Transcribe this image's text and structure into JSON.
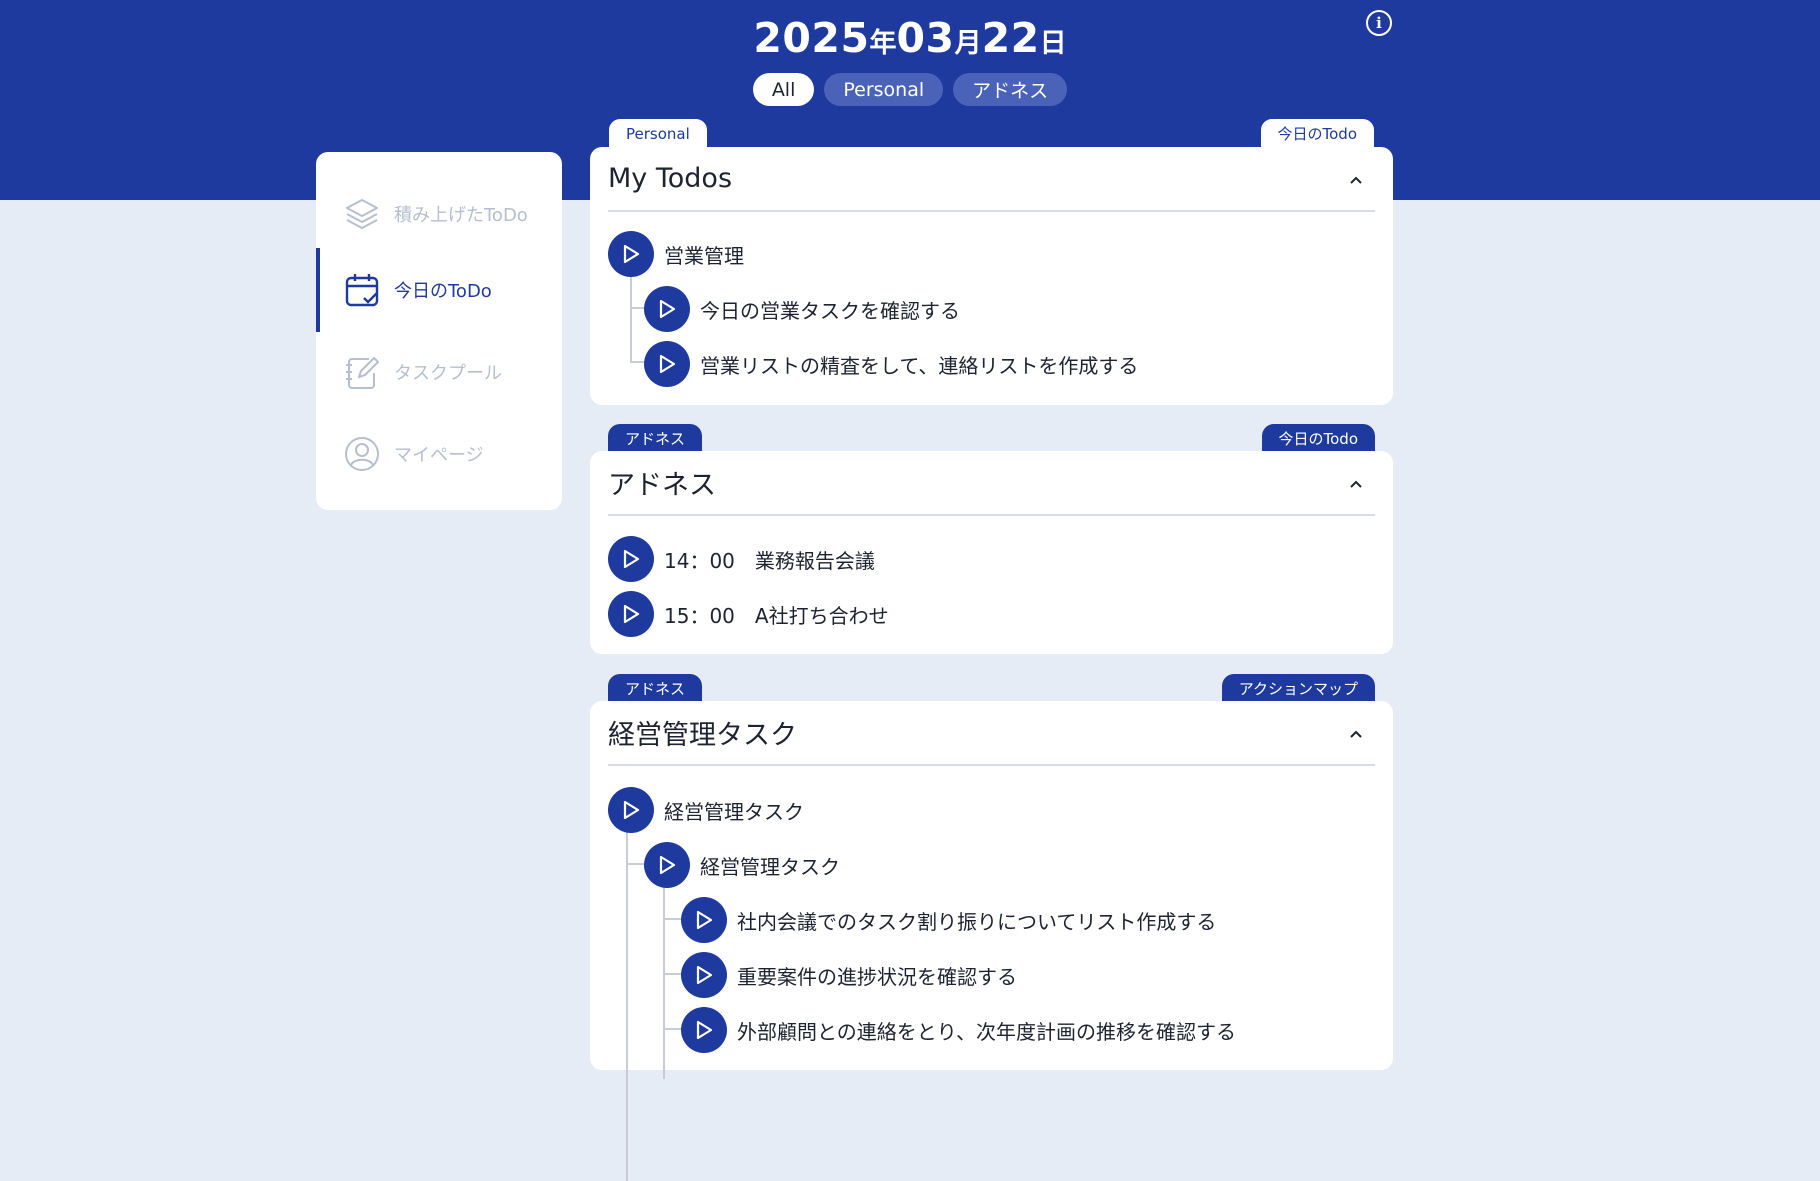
{
  "header": {
    "date_year": "2025",
    "date_year_suffix": "年",
    "date_month": "03",
    "date_month_suffix": "月",
    "date_day": "22",
    "date_day_suffix": "日",
    "info_icon": "info-icon",
    "filters": [
      "All",
      "Personal",
      "アドネス"
    ]
  },
  "sidebar": {
    "items": [
      {
        "label": "積み上げたToDo",
        "icon": "stack-layers-icon"
      },
      {
        "label": "今日のToDo",
        "icon": "calendar-check-icon"
      },
      {
        "label": "タスクプール",
        "icon": "notebook-edit-icon"
      },
      {
        "label": "マイページ",
        "icon": "user-circle-icon"
      }
    ]
  },
  "cards": [
    {
      "left_tab": "Personal",
      "right_tab": "今日のTodo",
      "title": "My Todos",
      "rows": [
        "営業管理",
        "今日の営業タスクを確認する",
        "営業リストの精査をして、連絡リストを作成する"
      ]
    },
    {
      "left_tab": "アドネス",
      "right_tab": "今日のTodo",
      "title": "アドネス",
      "rows": [
        "14：00　業務報告会議",
        "15：00　A社打ち合わせ"
      ]
    },
    {
      "left_tab": "アドネス",
      "right_tab": "アクションマップ",
      "title": "経営管理タスク",
      "rows": [
        "経営管理タスク",
        "経営管理タスク",
        "社内会議でのタスク割り振りについてリスト作成する",
        "重要案件の進捗状況を確認する",
        "外部顧問との連絡をとり、次年度計画の推移を確認する"
      ]
    }
  ],
  "colors": {
    "primary": "#1f3a9e",
    "background": "#e5ecf5",
    "muted": "#b6bfce"
  }
}
